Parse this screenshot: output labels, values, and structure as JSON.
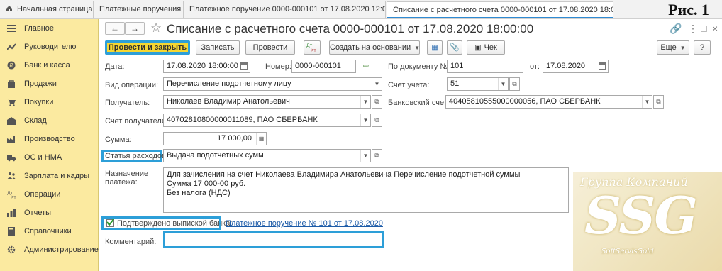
{
  "figure_label": "Рис. 1",
  "tabs": [
    {
      "label": "Начальная страница"
    },
    {
      "label": "Платежные поручения"
    },
    {
      "label": "Платежное поручение 0000-000101 от 17.08.2020 12:00:00"
    },
    {
      "label": "Списание с расчетного счета 0000-000101 от 17.08.2020 18:00:00"
    }
  ],
  "sidebar": {
    "items": [
      {
        "label": "Главное",
        "icon": "menu-icon"
      },
      {
        "label": "Руководителю",
        "icon": "trend-icon"
      },
      {
        "label": "Банк и касса",
        "icon": "coin-icon"
      },
      {
        "label": "Продажи",
        "icon": "bag-icon"
      },
      {
        "label": "Покупки",
        "icon": "cart-icon"
      },
      {
        "label": "Склад",
        "icon": "warehouse-icon"
      },
      {
        "label": "Производство",
        "icon": "factory-icon"
      },
      {
        "label": "ОС и НМА",
        "icon": "truck-icon"
      },
      {
        "label": "Зарплата и кадры",
        "icon": "people-icon"
      },
      {
        "label": "Операции",
        "icon": "dt-kt-icon"
      },
      {
        "label": "Отчеты",
        "icon": "report-icon"
      },
      {
        "label": "Справочники",
        "icon": "book-icon"
      },
      {
        "label": "Администрирование",
        "icon": "gear-icon"
      }
    ]
  },
  "header": {
    "title": "Списание с расчетного счета 0000-000101 от 17.08.2020 18:00:00"
  },
  "toolbar": {
    "post_and_close": "Провести и закрыть",
    "save": "Записать",
    "post": "Провести",
    "create_based_on": "Создать на основании",
    "check": "Чек",
    "more": "Еще",
    "help": "?"
  },
  "form": {
    "date_label": "Дата:",
    "date_value": "17.08.2020 18:00:00",
    "number_label": "Номер:",
    "number_value": "0000-000101",
    "by_document_label": "По документу №:",
    "by_document_value": "101",
    "from_label": "от:",
    "from_value": "17.08.2020",
    "operation_label": "Вид операции:",
    "operation_value": "Перечисление подотчетному лицу",
    "account_label": "Счет учета:",
    "account_value": "51",
    "recipient_label": "Получатель:",
    "recipient_value": "Николаев Владимир Анатольевич",
    "bank_account_label": "Банковский счет:",
    "bank_account_value": "40405810555000000056, ПАО СБЕРБАНК",
    "recipient_account_label": "Счет получателя:",
    "recipient_account_value": "40702810800000011089, ПАО СБЕРБАНК",
    "amount_label": "Сумма:",
    "amount_value": "17 000,00",
    "expense_item_label": "Статья расходов:",
    "expense_item_value": "Выдача подотчетных сумм",
    "purpose_label_1": "Назначение",
    "purpose_label_2": "платежа:",
    "purpose_lines": [
      "Для зачисления на счет Николаева Владимира Анатольевича Перечисление подотчетной суммы",
      "Сумма 17 000-00 руб.",
      "Без налога (НДС)"
    ],
    "confirmed_label": "Подтверждено выпиской банка:",
    "payment_order_link": "Платежное поручение № 101 от 17.08.2020",
    "comment_label": "Комментарий:",
    "comment_value": ""
  },
  "watermark": {
    "group": "Группа Компаний",
    "brand": "SSG",
    "sub": "SoftServisGold"
  },
  "colors": {
    "sidebar_bg": "#fbeaa0",
    "primary_button": "#f6d733",
    "highlight_border": "#2d9fd8",
    "link": "#1c5ba8"
  }
}
